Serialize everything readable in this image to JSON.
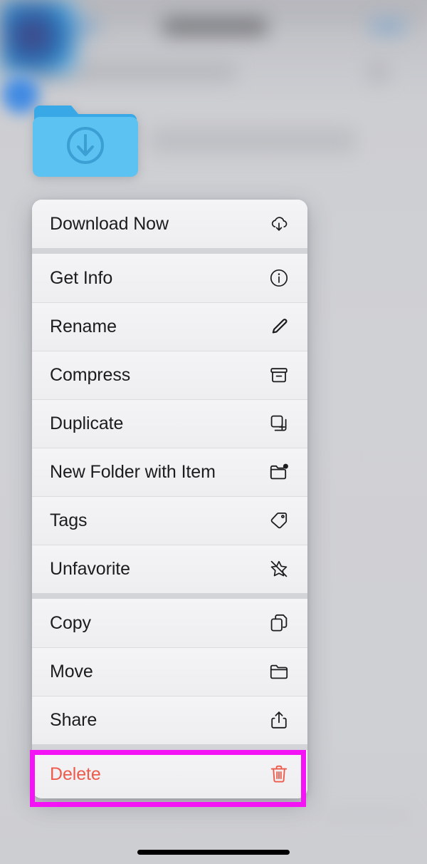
{
  "screen": {
    "app": "Files",
    "background_navbar_blurred": true
  },
  "focused_item": {
    "icon": "folder-download-icon",
    "color": "#4db8ef"
  },
  "context_menu": {
    "groups": [
      {
        "group_name": "download-group",
        "items": [
          {
            "label": "Download Now",
            "icon": "cloud-download-icon",
            "destructive": false
          }
        ]
      },
      {
        "group_name": "file-actions-group",
        "items": [
          {
            "label": "Get Info",
            "icon": "info-circle-icon",
            "destructive": false
          },
          {
            "label": "Rename",
            "icon": "pencil-icon",
            "destructive": false
          },
          {
            "label": "Compress",
            "icon": "archivebox-icon",
            "destructive": false
          },
          {
            "label": "Duplicate",
            "icon": "duplicate-icon",
            "destructive": false
          },
          {
            "label": "New Folder with Item",
            "icon": "folder-badge-plus-icon",
            "destructive": false
          },
          {
            "label": "Tags",
            "icon": "tag-icon",
            "destructive": false
          },
          {
            "label": "Unfavorite",
            "icon": "star-slash-icon",
            "destructive": false
          }
        ]
      },
      {
        "group_name": "transfer-group",
        "items": [
          {
            "label": "Copy",
            "icon": "copy-icon",
            "destructive": false
          },
          {
            "label": "Move",
            "icon": "folder-icon",
            "destructive": false
          },
          {
            "label": "Share",
            "icon": "share-up-icon",
            "destructive": false
          }
        ]
      },
      {
        "group_name": "destructive-group",
        "items": [
          {
            "label": "Delete",
            "icon": "trash-icon",
            "destructive": true
          }
        ]
      }
    ]
  },
  "highlight": {
    "target_label": "Delete",
    "color": "#f413f4",
    "border_width_px": 7
  },
  "colors": {
    "menu_background": "#f1f1f3",
    "separator": "#dcdce0",
    "group_separator": "#d3d4d8",
    "label_text": "#1c1c1e",
    "destructive_text": "#ec5b4c",
    "folder_blue": "#4db8ef",
    "highlight_magenta": "#f413f4"
  },
  "home_indicator": {
    "visible": true
  }
}
